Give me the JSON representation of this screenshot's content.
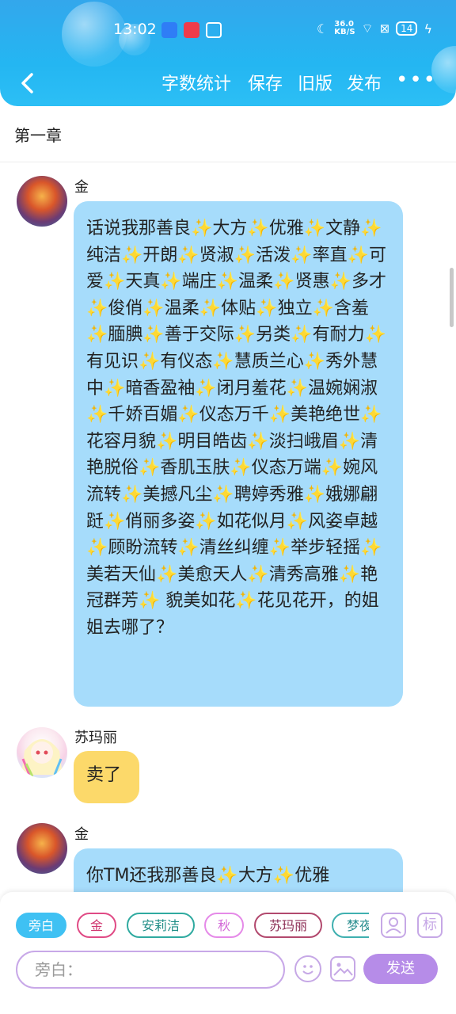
{
  "status_bar": {
    "time": "13:02",
    "speed": "36.0\nKB/S",
    "battery": "14"
  },
  "toolbar": {
    "back_icon": "chevron-left-icon",
    "actions": [
      "字数统计",
      "保存",
      "旧版",
      "发布"
    ],
    "more_icon": "more-dots-icon"
  },
  "chapter_title": "第一章",
  "messages": [
    {
      "speaker": "金",
      "text": "话说我那善良✨大方✨优雅✨文静✨纯洁✨开朗✨贤淑✨活泼✨率直✨可爱✨天真✨端庄✨温柔✨贤惠✨多才✨俊俏✨温柔✨体贴✨独立✨含羞✨腼腆✨善于交际✨另类✨有耐力✨有见识✨有仪态✨慧质兰心✨秀外慧中✨暗香盈袖✨闭月羞花✨温婉娴淑✨千娇百媚✨仪态万千✨美艳绝世✨花容月貌✨明目皓齿✨淡扫峨眉✨清艳脱俗✨香肌玉肤✨仪态万端✨婉风流转✨美撼凡尘✨聘婷秀雅✨娥娜翩跹✨俏丽多姿✨如花似月✨风姿卓越✨顾盼流转✨清丝纠缠✨举步轻摇✨美若天仙✨美愈天人✨清秀高雅✨艳冠群芳✨ 貌美如花✨花见花开，的姐姐去哪了？"
    },
    {
      "speaker": "苏玛丽",
      "text": "卖了"
    },
    {
      "speaker": "金",
      "text": "你TM还我那善良✨大方✨优雅"
    }
  ],
  "characters": [
    "旁白",
    "金",
    "安莉洁",
    "秋",
    "苏玛丽",
    "梦夜"
  ],
  "colors": {
    "header": "#2cb3f1",
    "bubble_blue": "#a6dcfb",
    "bubble_yellow": "#fcd96a",
    "accent_purple": "#b68ce8",
    "chip_active": "#3fc1f3"
  },
  "input": {
    "placeholder": "旁白："
  },
  "send_label": "发送",
  "right_icons": [
    "character-icon",
    "mark-icon"
  ],
  "mark_label": "标"
}
